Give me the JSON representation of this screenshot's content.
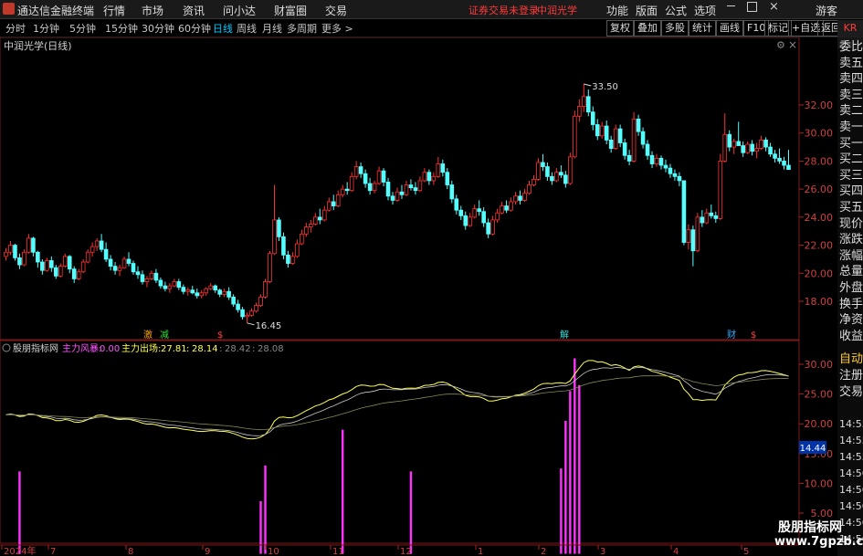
{
  "app": {
    "title": "通达信金融终端"
  },
  "menu": [
    "行情",
    "市场",
    "资讯",
    "问小达",
    "财富圈",
    "交易"
  ],
  "status": {
    "securities_login": "证券交易未登录",
    "stock_name": "中润光学"
  },
  "menu_right": [
    "功能",
    "版面",
    "公式",
    "选项",
    "游客"
  ],
  "periods": [
    "分时",
    "1分钟",
    "5分钟",
    "15分钟",
    "30分钟",
    "60分钟",
    "日线",
    "周线",
    "月线",
    "多周期",
    "更多 >"
  ],
  "active_period": "日线",
  "toolbar_buttons": [
    "复权",
    "叠加",
    "多股",
    "统计",
    "画线",
    "F10",
    "标记",
    "+自选",
    "返回"
  ],
  "chart_title": "中润光学(日线)",
  "main_axis": {
    "ticks": [
      "32.00",
      "30.00",
      "28.00",
      "26.00",
      "24.00",
      "22.00",
      "20.00",
      "18.00"
    ]
  },
  "annotations": {
    "high": "33.50",
    "low": "16.45"
  },
  "event_marks": [
    "激",
    "减",
    "$",
    "解",
    "财",
    "$"
  ],
  "indicator": {
    "name": "股朋指标网",
    "label1": "主力风暴:",
    "value1": "0.00",
    "label2": "主力出场:",
    "value2": "27.81",
    "value3": "28.14",
    "value4": "28.42",
    "value5": "28.08",
    "axis_ticks": [
      "30.00",
      "25.00",
      "20.00",
      "15.00",
      "10.00",
      "5.00"
    ],
    "current": "14.44"
  },
  "order_book": [
    "委比",
    "卖五",
    "卖四",
    "卖三",
    "卖二",
    "卖一",
    "买一",
    "买二",
    "买三",
    "买四",
    "买五",
    "现价",
    "涨跌",
    "涨幅",
    "总量",
    "外盘",
    "换手",
    "净资",
    "收益"
  ],
  "side_tabs": [
    "自动",
    "注册",
    "交易"
  ],
  "side_times": [
    "14:55",
    "14:55",
    "14:55",
    "14:56",
    "14:56",
    "14:56",
    "14:56",
    "14:56"
  ],
  "corner_label": "KR",
  "date_axis": [
    "2024年",
    "7",
    "8",
    "9",
    "10",
    "11",
    "12",
    "1",
    "2",
    "3",
    "4",
    "5"
  ],
  "watermark": {
    "line1": "股朋指标网",
    "line2": "www.7gpzb.com"
  },
  "colors": {
    "up": "#ff3232",
    "down": "#54ffff",
    "bar": "#ff33ff",
    "line1": "#ffff55",
    "line2": "#c8c8c8"
  },
  "chart_data": {
    "type": "candlestick",
    "ylim": [
      16,
      34
    ],
    "candles": [
      [
        21.2,
        21.8,
        20.9,
        21.5
      ],
      [
        21.5,
        22.3,
        21.3,
        22.0
      ],
      [
        22.0,
        22.1,
        20.9,
        21.1
      ],
      [
        21.1,
        21.4,
        20.3,
        20.6
      ],
      [
        20.6,
        21.7,
        20.5,
        21.5
      ],
      [
        21.5,
        22.8,
        21.4,
        22.5
      ],
      [
        22.5,
        22.6,
        21.2,
        21.5
      ],
      [
        21.5,
        21.6,
        20.4,
        20.8
      ],
      [
        20.8,
        21.0,
        19.9,
        20.2
      ],
      [
        20.2,
        21.1,
        20.1,
        20.9
      ],
      [
        20.9,
        21.2,
        20.1,
        20.4
      ],
      [
        20.4,
        20.6,
        19.6,
        19.8
      ],
      [
        19.8,
        20.7,
        19.7,
        20.5
      ],
      [
        20.5,
        21.4,
        20.4,
        21.2
      ],
      [
        21.2,
        21.3,
        20.0,
        20.3
      ],
      [
        20.3,
        20.5,
        19.3,
        19.6
      ],
      [
        19.6,
        20.3,
        19.5,
        20.1
      ],
      [
        20.1,
        21.0,
        20.0,
        20.8
      ],
      [
        20.8,
        21.7,
        20.7,
        21.5
      ],
      [
        21.5,
        22.2,
        21.2,
        21.9
      ],
      [
        21.9,
        22.5,
        21.6,
        22.3
      ],
      [
        22.3,
        22.8,
        21.5,
        21.7
      ],
      [
        21.7,
        22.2,
        20.8,
        21.0
      ],
      [
        21.0,
        21.3,
        20.2,
        20.5
      ],
      [
        20.5,
        20.8,
        19.9,
        20.2
      ],
      [
        20.2,
        20.6,
        19.8,
        20.4
      ],
      [
        20.4,
        21.2,
        20.3,
        21.0
      ],
      [
        21.0,
        21.5,
        20.5,
        20.7
      ],
      [
        20.7,
        20.9,
        19.9,
        20.1
      ],
      [
        20.1,
        20.5,
        19.6,
        19.9
      ],
      [
        19.9,
        20.2,
        19.2,
        19.4
      ],
      [
        19.4,
        19.8,
        19.0,
        19.6
      ],
      [
        19.6,
        20.2,
        19.5,
        20.0
      ],
      [
        20.0,
        20.3,
        19.3,
        19.5
      ],
      [
        19.5,
        19.7,
        18.9,
        19.1
      ],
      [
        19.1,
        19.4,
        18.7,
        18.9
      ],
      [
        18.9,
        19.3,
        18.6,
        19.1
      ],
      [
        19.1,
        19.6,
        19.0,
        19.4
      ],
      [
        19.4,
        19.6,
        18.8,
        19.0
      ],
      [
        19.0,
        19.2,
        18.5,
        18.7
      ],
      [
        18.7,
        19.0,
        18.4,
        18.8
      ],
      [
        18.8,
        19.1,
        18.5,
        18.6
      ],
      [
        18.6,
        18.9,
        18.2,
        18.4
      ],
      [
        18.4,
        18.8,
        18.2,
        18.6
      ],
      [
        18.6,
        19.0,
        18.4,
        18.9
      ],
      [
        18.9,
        19.3,
        18.8,
        19.1
      ],
      [
        19.1,
        19.2,
        18.6,
        18.8
      ],
      [
        18.8,
        18.9,
        18.3,
        18.5
      ],
      [
        18.5,
        18.9,
        18.3,
        18.7
      ],
      [
        18.7,
        19.0,
        18.1,
        18.3
      ],
      [
        18.3,
        18.5,
        17.6,
        17.8
      ],
      [
        17.8,
        18.1,
        17.2,
        17.4
      ],
      [
        17.4,
        17.6,
        16.7,
        16.9
      ],
      [
        16.9,
        17.2,
        16.45,
        17.0
      ],
      [
        17.0,
        17.5,
        16.9,
        17.3
      ],
      [
        17.3,
        17.9,
        17.2,
        17.7
      ],
      [
        17.7,
        18.5,
        17.6,
        18.3
      ],
      [
        18.3,
        19.6,
        18.2,
        19.4
      ],
      [
        19.4,
        21.6,
        19.3,
        21.4
      ],
      [
        21.4,
        26.3,
        21.3,
        23.8
      ],
      [
        23.8,
        24.0,
        22.3,
        22.6
      ],
      [
        22.6,
        22.9,
        21.0,
        21.3
      ],
      [
        21.3,
        21.6,
        20.4,
        20.7
      ],
      [
        20.7,
        21.5,
        20.6,
        21.2
      ],
      [
        21.2,
        22.4,
        21.1,
        22.1
      ],
      [
        22.1,
        23.1,
        22.0,
        22.8
      ],
      [
        22.8,
        23.6,
        22.6,
        23.3
      ],
      [
        23.3,
        23.8,
        22.9,
        23.5
      ],
      [
        23.5,
        24.3,
        23.4,
        24.0
      ],
      [
        24.0,
        24.6,
        23.5,
        23.8
      ],
      [
        23.8,
        24.8,
        23.7,
        24.5
      ],
      [
        24.5,
        25.4,
        24.4,
        25.1
      ],
      [
        25.1,
        25.6,
        24.5,
        24.8
      ],
      [
        24.8,
        25.9,
        24.7,
        25.6
      ],
      [
        25.6,
        26.3,
        25.4,
        26.0
      ],
      [
        26.0,
        26.5,
        25.6,
        25.9
      ],
      [
        25.9,
        27.2,
        25.8,
        26.9
      ],
      [
        26.9,
        28.0,
        26.7,
        27.6
      ],
      [
        27.6,
        27.9,
        26.8,
        27.1
      ],
      [
        27.1,
        27.4,
        26.1,
        26.4
      ],
      [
        26.4,
        26.8,
        25.6,
        25.9
      ],
      [
        25.9,
        26.6,
        25.7,
        26.4
      ],
      [
        26.4,
        27.6,
        26.3,
        27.3
      ],
      [
        27.3,
        27.5,
        26.2,
        26.5
      ],
      [
        26.5,
        26.8,
        25.2,
        25.5
      ],
      [
        25.5,
        25.8,
        24.9,
        25.2
      ],
      [
        25.2,
        26.1,
        25.1,
        25.8
      ],
      [
        25.8,
        26.3,
        25.3,
        25.6
      ],
      [
        25.6,
        26.6,
        25.5,
        26.3
      ],
      [
        26.3,
        26.7,
        25.9,
        26.1
      ],
      [
        26.1,
        26.5,
        25.6,
        25.9
      ],
      [
        25.9,
        26.9,
        25.8,
        26.6
      ],
      [
        26.6,
        27.5,
        26.5,
        27.2
      ],
      [
        27.2,
        27.4,
        26.3,
        26.6
      ],
      [
        26.6,
        27.2,
        26.3,
        26.9
      ],
      [
        26.9,
        28.3,
        26.8,
        27.8
      ],
      [
        27.8,
        28.1,
        26.9,
        27.2
      ],
      [
        27.2,
        27.5,
        26.0,
        26.3
      ],
      [
        26.3,
        26.6,
        25.0,
        25.3
      ],
      [
        25.3,
        25.6,
        24.2,
        24.5
      ],
      [
        24.5,
        24.8,
        23.8,
        24.1
      ],
      [
        24.1,
        24.4,
        23.1,
        23.4
      ],
      [
        23.4,
        24.3,
        23.3,
        24.0
      ],
      [
        24.0,
        24.9,
        23.9,
        24.6
      ],
      [
        24.6,
        25.2,
        24.1,
        24.4
      ],
      [
        24.4,
        24.7,
        23.3,
        23.6
      ],
      [
        23.6,
        23.9,
        22.5,
        22.8
      ],
      [
        22.8,
        24.1,
        22.7,
        23.8
      ],
      [
        23.8,
        24.6,
        23.6,
        24.3
      ],
      [
        24.3,
        25.1,
        24.2,
        24.8
      ],
      [
        24.8,
        25.2,
        24.3,
        24.5
      ],
      [
        24.5,
        25.4,
        24.4,
        25.1
      ],
      [
        25.1,
        25.8,
        24.9,
        25.5
      ],
      [
        25.5,
        25.9,
        24.9,
        25.2
      ],
      [
        25.2,
        26.0,
        25.1,
        25.7
      ],
      [
        25.7,
        26.6,
        25.6,
        26.3
      ],
      [
        26.3,
        27.0,
        26.2,
        26.7
      ],
      [
        26.7,
        28.2,
        26.6,
        27.9
      ],
      [
        27.9,
        28.5,
        27.3,
        27.6
      ],
      [
        27.6,
        27.9,
        26.6,
        26.9
      ],
      [
        26.9,
        27.2,
        26.3,
        26.6
      ],
      [
        26.6,
        27.5,
        26.5,
        27.2
      ],
      [
        27.2,
        27.7,
        26.8,
        27.0
      ],
      [
        27.0,
        27.3,
        26.1,
        26.4
      ],
      [
        26.4,
        28.6,
        26.3,
        28.3
      ],
      [
        28.3,
        31.6,
        28.2,
        31.2
      ],
      [
        31.2,
        32.4,
        30.8,
        31.9
      ],
      [
        31.9,
        33.5,
        31.5,
        32.6
      ],
      [
        32.6,
        33.1,
        31.2,
        31.5
      ],
      [
        31.5,
        31.9,
        30.2,
        30.6
      ],
      [
        30.6,
        31.0,
        29.5,
        29.8
      ],
      [
        29.8,
        30.8,
        29.6,
        30.5
      ],
      [
        30.5,
        30.9,
        29.2,
        29.5
      ],
      [
        29.5,
        29.8,
        28.6,
        28.9
      ],
      [
        28.9,
        30.6,
        28.8,
        30.3
      ],
      [
        30.3,
        30.6,
        29.0,
        29.3
      ],
      [
        29.3,
        29.6,
        28.1,
        28.4
      ],
      [
        28.4,
        28.8,
        27.7,
        28.0
      ],
      [
        28.0,
        31.5,
        27.9,
        31.0
      ],
      [
        31.0,
        31.3,
        29.8,
        30.1
      ],
      [
        30.1,
        30.4,
        28.9,
        29.2
      ],
      [
        29.2,
        29.5,
        28.1,
        28.4
      ],
      [
        28.4,
        28.7,
        27.5,
        27.8
      ],
      [
        27.8,
        28.5,
        27.6,
        28.2
      ],
      [
        28.2,
        28.4,
        27.4,
        27.7
      ],
      [
        27.7,
        28.1,
        27.2,
        27.5
      ],
      [
        27.5,
        27.8,
        26.8,
        27.1
      ],
      [
        27.1,
        27.4,
        26.6,
        26.9
      ],
      [
        26.9,
        27.2,
        26.2,
        26.6
      ],
      [
        26.6,
        25.0,
        22.0,
        22.2
      ],
      [
        22.2,
        23.5,
        21.7,
        23.1
      ],
      [
        23.1,
        23.4,
        20.5,
        21.6
      ],
      [
        21.6,
        24.3,
        21.5,
        24.0
      ],
      [
        24.0,
        24.5,
        23.3,
        23.6
      ],
      [
        23.6,
        24.6,
        23.5,
        24.3
      ],
      [
        24.3,
        24.9,
        23.9,
        24.1
      ],
      [
        24.1,
        24.4,
        23.6,
        23.9
      ],
      [
        23.9,
        28.5,
        23.8,
        28.0
      ],
      [
        28.0,
        31.4,
        27.9,
        29.9
      ],
      [
        29.9,
        30.2,
        28.7,
        29.0
      ],
      [
        29.0,
        29.6,
        28.5,
        29.4
      ],
      [
        29.4,
        30.8,
        29.3,
        29.1
      ],
      [
        29.1,
        29.4,
        28.3,
        28.6
      ],
      [
        28.6,
        29.4,
        28.5,
        29.2
      ],
      [
        29.2,
        29.5,
        28.4,
        28.7
      ],
      [
        28.7,
        29.3,
        28.2,
        28.9
      ],
      [
        28.9,
        29.8,
        28.8,
        29.5
      ],
      [
        29.5,
        29.7,
        28.7,
        29.0
      ],
      [
        29.0,
        29.3,
        28.3,
        28.5
      ],
      [
        28.5,
        28.8,
        27.9,
        28.2
      ],
      [
        28.2,
        28.9,
        27.8,
        28.0
      ],
      [
        28.0,
        28.3,
        27.4,
        27.7
      ],
      [
        27.7,
        28.8,
        27.6,
        27.4
      ]
    ],
    "indicator_bars": [
      {
        "i": 3,
        "v": 12.0
      },
      {
        "i": 56,
        "v": 7.0
      },
      {
        "i": 57,
        "v": 13.0
      },
      {
        "i": 74,
        "v": 19.0
      },
      {
        "i": 89,
        "v": 12.0
      },
      {
        "i": 122,
        "v": 12.5
      },
      {
        "i": 123,
        "v": 20.5
      },
      {
        "i": 124,
        "v": 25.5
      },
      {
        "i": 125,
        "v": 31.0
      },
      {
        "i": 126,
        "v": 26.5
      }
    ]
  }
}
